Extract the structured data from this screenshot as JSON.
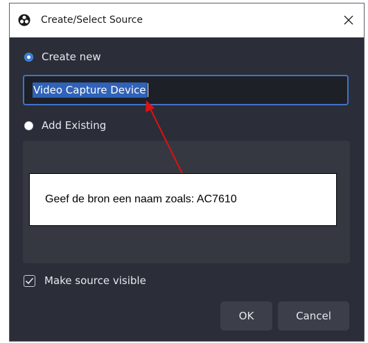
{
  "window": {
    "title": "Create/Select Source",
    "close_icon": "close-icon",
    "app_icon": "obs-logo-icon"
  },
  "form": {
    "create_new_label": "Create new",
    "create_new_selected": true,
    "source_name_value": "Video Capture Device",
    "add_existing_label": "Add Existing",
    "add_existing_selected": false,
    "make_visible_label": "Make source visible",
    "make_visible_checked": true
  },
  "annotation": {
    "callout_text": "Geef de bron een naam zoals: AC7610",
    "arrow_color": "#e01010"
  },
  "buttons": {
    "ok_label": "OK",
    "cancel_label": "Cancel"
  },
  "colors": {
    "dialog_bg": "#2b2e38",
    "accent": "#3a7bd5",
    "button_bg": "#3c3f49"
  }
}
